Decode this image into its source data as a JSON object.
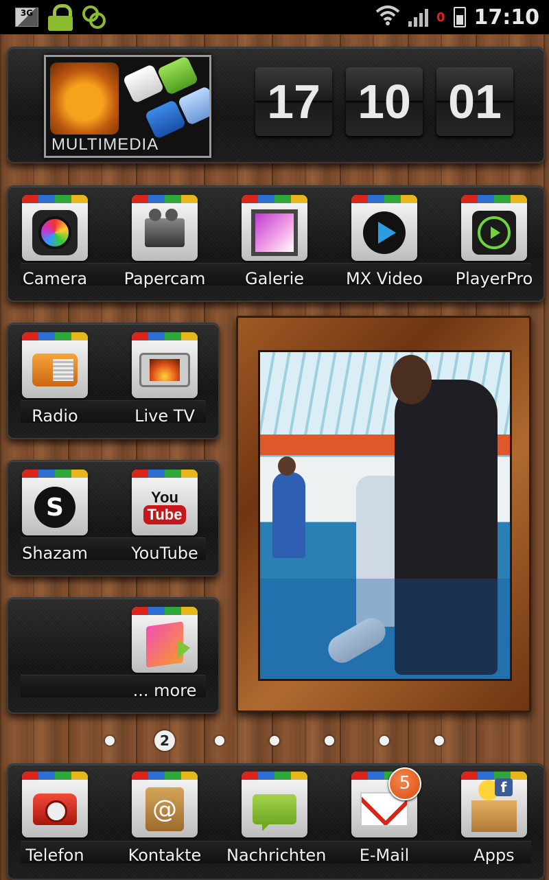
{
  "status_bar": {
    "network": "3G",
    "time": "17:10",
    "unread_indicator": "0",
    "icons": [
      "3g-icon",
      "lock-icon",
      "sync-icon",
      "wifi-icon",
      "signal-icon",
      "battery-charging-icon"
    ]
  },
  "widget": {
    "title": "MULTIMEDIA",
    "clock": {
      "hours": "17",
      "minutes": "10",
      "seconds": "01"
    }
  },
  "row1": [
    {
      "label": "Camera",
      "icon": "camera-fx-icon"
    },
    {
      "label": "Papercam",
      "icon": "movie-camera-icon"
    },
    {
      "label": "Galerie",
      "icon": "gallery-icon"
    },
    {
      "label": "MX Video",
      "icon": "play-icon"
    },
    {
      "label": "PlayerPro",
      "icon": "music-player-icon"
    }
  ],
  "row2": [
    {
      "label": "Radio",
      "icon": "radio-icon"
    },
    {
      "label": "Live TV",
      "icon": "tv-icon"
    }
  ],
  "row3": [
    {
      "label": "Shazam",
      "icon": "shazam-icon"
    },
    {
      "label": "YouTube",
      "icon": "youtube-icon",
      "icon_text_top": "You",
      "icon_text_bottom": "Tube"
    }
  ],
  "row4": [
    {
      "label": "... more",
      "icon": "folder-icon"
    }
  ],
  "pager": {
    "current": "2"
  },
  "dock": [
    {
      "label": "Telefon",
      "icon": "phone-icon"
    },
    {
      "label": "Kontakte",
      "icon": "contacts-icon"
    },
    {
      "label": "Nachrichten",
      "icon": "messages-icon"
    },
    {
      "label": "E-Mail",
      "icon": "email-icon",
      "badge": "5"
    },
    {
      "label": "Apps",
      "icon": "apps-box-icon"
    }
  ],
  "colors": {
    "stripe": [
      "#d9261c",
      "#2f6fd0",
      "#2fa63a",
      "#e6b61e"
    ],
    "badge": "#e0571f",
    "accent_green": "#8bbb2f"
  }
}
